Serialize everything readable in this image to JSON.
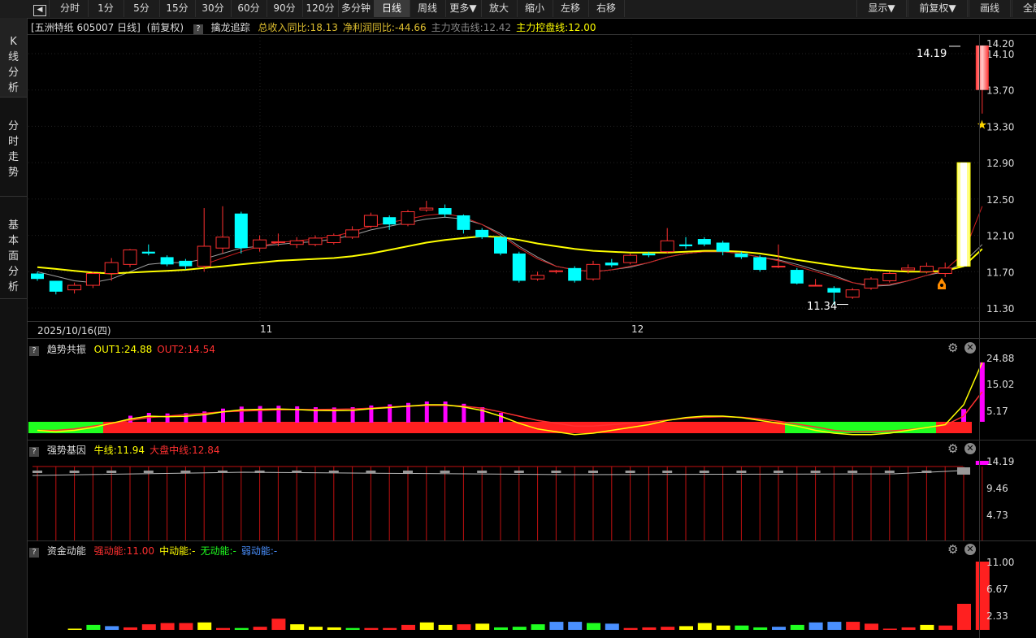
{
  "toolbar": {
    "buttons": [
      "分时",
      "1分",
      "5分",
      "15分",
      "30分",
      "60分",
      "90分",
      "120分",
      "多分钟",
      "日线",
      "周线",
      "更多▼",
      "放大",
      "缩小",
      "左移",
      "右移"
    ],
    "active": "日线",
    "right_buttons": [
      "显示▼",
      "前复权▼",
      "画线",
      "全屏"
    ]
  },
  "sidebar": {
    "tabs": [
      {
        "label": "K线分析",
        "chars": [
          "K",
          "线",
          "分",
          "析"
        ]
      },
      {
        "label": "分时走势",
        "chars": [
          "分",
          "时",
          "走",
          "势"
        ]
      },
      {
        "label": "基本面分析",
        "chars": [
          "基",
          "本",
          "面",
          "分",
          "析"
        ]
      }
    ]
  },
  "main_panel": {
    "stock": "[五洲特纸 605007 日线]",
    "adjust": "(前复权)",
    "indicator": "擒龙追踪",
    "items": [
      {
        "text": "总收入同比:18.13",
        "color": "#e0c030"
      },
      {
        "text": "净利润同比:-44.66",
        "color": "#e0c030"
      },
      {
        "text": "主力攻击线:12.42",
        "color": "#888888"
      },
      {
        "text": "主力控盘线:12.00",
        "color": "#ffff00"
      }
    ],
    "y_ticks": [
      "14.20",
      "14.10",
      "13.70",
      "13.30",
      "12.90",
      "12.50",
      "12.10",
      "11.70",
      "11.30"
    ],
    "high_label": "14.19",
    "low_label": "11.34",
    "dates": [
      "2025/10/16(四)",
      "11",
      "12"
    ]
  },
  "panel2": {
    "name": "趋势共振",
    "items": [
      {
        "text": "OUT1:24.88",
        "color": "#ffff00"
      },
      {
        "text": "OUT2:14.54",
        "color": "#ff3030"
      }
    ],
    "y_ticks": [
      "24.88",
      "15.02",
      "5.17"
    ]
  },
  "panel3": {
    "name": "强势基因",
    "items": [
      {
        "text": "牛线:11.94",
        "color": "#ffff00"
      },
      {
        "text": "大盘中线:12.84",
        "color": "#ff3030"
      }
    ],
    "y_ticks": [
      "14.19",
      "9.46",
      "4.73"
    ]
  },
  "panel4": {
    "name": "资金动能",
    "items": [
      {
        "text": "强动能:11.00",
        "color": "#ff3030"
      },
      {
        "text": "中动能:-",
        "color": "#ffff00"
      },
      {
        "text": "无动能:-",
        "color": "#20ff20"
      },
      {
        "text": "弱动能:-",
        "color": "#4a90ff"
      }
    ],
    "y_ticks": [
      "11.00",
      "6.67",
      "2.33"
    ]
  },
  "colors": {
    "up": "#ff3030",
    "down": "#00ffff",
    "ma_yellow": "#ffff00",
    "ma_gray": "#a0a0a0"
  },
  "chart_data": [
    {
      "type": "candlestick",
      "title": "五洲特纸 605007 日线",
      "candles": [
        {
          "o": 11.68,
          "h": 11.7,
          "l": 11.6,
          "c": 11.62
        },
        {
          "o": 11.6,
          "h": 11.6,
          "l": 11.45,
          "c": 11.48
        },
        {
          "o": 11.5,
          "h": 11.58,
          "l": 11.46,
          "c": 11.55
        },
        {
          "o": 11.55,
          "h": 11.7,
          "l": 11.52,
          "c": 11.68
        },
        {
          "o": 11.68,
          "h": 11.85,
          "l": 11.6,
          "c": 11.8
        },
        {
          "o": 11.78,
          "h": 11.95,
          "l": 11.75,
          "c": 11.94
        },
        {
          "o": 11.92,
          "h": 12.0,
          "l": 11.88,
          "c": 11.9
        },
        {
          "o": 11.86,
          "h": 11.88,
          "l": 11.76,
          "c": 11.78
        },
        {
          "o": 11.82,
          "h": 11.84,
          "l": 11.72,
          "c": 11.76
        },
        {
          "o": 11.76,
          "h": 12.4,
          "l": 11.7,
          "c": 11.98
        },
        {
          "o": 11.96,
          "h": 12.42,
          "l": 11.9,
          "c": 12.08
        },
        {
          "o": 12.34,
          "h": 12.36,
          "l": 11.9,
          "c": 11.96
        },
        {
          "o": 11.96,
          "h": 12.1,
          "l": 11.92,
          "c": 12.05
        },
        {
          "o": 12.02,
          "h": 12.12,
          "l": 11.98,
          "c": 12.03
        },
        {
          "o": 12.0,
          "h": 12.08,
          "l": 11.96,
          "c": 12.04
        },
        {
          "o": 12.0,
          "h": 12.1,
          "l": 11.98,
          "c": 12.07
        },
        {
          "o": 12.02,
          "h": 12.12,
          "l": 12.0,
          "c": 12.1
        },
        {
          "o": 12.08,
          "h": 12.2,
          "l": 12.06,
          "c": 12.16
        },
        {
          "o": 12.2,
          "h": 12.35,
          "l": 12.18,
          "c": 12.32
        },
        {
          "o": 12.3,
          "h": 12.32,
          "l": 12.16,
          "c": 12.22
        },
        {
          "o": 12.22,
          "h": 12.38,
          "l": 12.2,
          "c": 12.36
        },
        {
          "o": 12.38,
          "h": 12.48,
          "l": 12.36,
          "c": 12.4
        },
        {
          "o": 12.4,
          "h": 12.44,
          "l": 12.3,
          "c": 12.33
        },
        {
          "o": 12.32,
          "h": 12.33,
          "l": 12.12,
          "c": 12.16
        },
        {
          "o": 12.16,
          "h": 12.18,
          "l": 12.06,
          "c": 12.08
        },
        {
          "o": 12.08,
          "h": 12.1,
          "l": 11.88,
          "c": 11.9
        },
        {
          "o": 11.9,
          "h": 11.92,
          "l": 11.58,
          "c": 11.6
        },
        {
          "o": 11.62,
          "h": 11.7,
          "l": 11.6,
          "c": 11.66
        },
        {
          "o": 11.7,
          "h": 11.72,
          "l": 11.68,
          "c": 11.71
        },
        {
          "o": 11.74,
          "h": 11.76,
          "l": 11.58,
          "c": 11.6
        },
        {
          "o": 11.62,
          "h": 11.82,
          "l": 11.6,
          "c": 11.78
        },
        {
          "o": 11.8,
          "h": 11.84,
          "l": 11.75,
          "c": 11.77
        },
        {
          "o": 11.8,
          "h": 11.9,
          "l": 11.78,
          "c": 11.88
        },
        {
          "o": 11.9,
          "h": 11.92,
          "l": 11.86,
          "c": 11.88
        },
        {
          "o": 11.92,
          "h": 12.18,
          "l": 11.9,
          "c": 12.04
        },
        {
          "o": 12.0,
          "h": 12.08,
          "l": 11.95,
          "c": 11.98
        },
        {
          "o": 12.06,
          "h": 12.08,
          "l": 11.98,
          "c": 12.0
        },
        {
          "o": 12.02,
          "h": 12.04,
          "l": 11.88,
          "c": 11.92
        },
        {
          "o": 11.9,
          "h": 11.92,
          "l": 11.84,
          "c": 11.86
        },
        {
          "o": 11.86,
          "h": 11.88,
          "l": 11.7,
          "c": 11.72
        },
        {
          "o": 11.76,
          "h": 12.0,
          "l": 11.74,
          "c": 11.76
        },
        {
          "o": 11.72,
          "h": 11.74,
          "l": 11.56,
          "c": 11.57
        },
        {
          "o": 11.55,
          "h": 11.62,
          "l": 11.54,
          "c": 11.55
        },
        {
          "o": 11.52,
          "h": 11.54,
          "l": 11.34,
          "c": 11.47
        },
        {
          "o": 11.42,
          "h": 11.52,
          "l": 11.4,
          "c": 11.5
        },
        {
          "o": 11.52,
          "h": 11.64,
          "l": 11.5,
          "c": 11.62
        },
        {
          "o": 11.6,
          "h": 11.7,
          "l": 11.58,
          "c": 11.68
        },
        {
          "o": 11.72,
          "h": 11.78,
          "l": 11.68,
          "c": 11.74
        },
        {
          "o": 11.7,
          "h": 11.8,
          "l": 11.68,
          "c": 11.76
        },
        {
          "o": 11.68,
          "h": 11.8,
          "l": 11.64,
          "c": 11.74
        },
        {
          "o": 11.76,
          "h": 12.9,
          "l": 11.76,
          "c": 12.9
        },
        {
          "o": 14.19,
          "h": 14.19,
          "l": 13.44,
          "c": 13.7
        }
      ],
      "ma_yellow": [
        11.75,
        11.73,
        11.71,
        11.69,
        11.68,
        11.69,
        11.7,
        11.71,
        11.72,
        11.74,
        11.76,
        11.78,
        11.8,
        11.82,
        11.83,
        11.84,
        11.85,
        11.87,
        11.9,
        11.94,
        11.98,
        12.02,
        12.05,
        12.07,
        12.09,
        12.08,
        12.05,
        12.01,
        11.98,
        11.95,
        11.93,
        11.92,
        11.91,
        11.91,
        11.91,
        11.92,
        11.93,
        11.93,
        11.92,
        11.9,
        11.87,
        11.83,
        11.8,
        11.77,
        11.74,
        11.72,
        11.71,
        11.7,
        11.7,
        11.71,
        11.76,
        11.95
      ],
      "ma_gray": [
        11.7,
        11.65,
        11.6,
        11.58,
        11.62,
        11.7,
        11.78,
        11.8,
        11.8,
        11.84,
        11.9,
        11.96,
        11.98,
        12.0,
        12.02,
        12.03,
        12.06,
        12.1,
        12.16,
        12.2,
        12.24,
        12.28,
        12.3,
        12.28,
        12.22,
        12.12,
        11.98,
        11.86,
        11.76,
        11.72,
        11.7,
        11.72,
        11.75,
        11.8,
        11.86,
        11.9,
        11.92,
        11.92,
        11.9,
        11.86,
        11.83,
        11.78,
        11.72,
        11.66,
        11.58,
        11.54,
        11.55,
        11.6,
        11.66,
        11.7,
        11.8,
        12.0
      ],
      "ma_red": [
        null,
        null,
        null,
        null,
        null,
        null,
        null,
        null,
        null,
        11.78,
        11.85,
        11.92,
        11.98,
        12.02,
        12.04,
        12.06,
        12.09,
        12.14,
        12.2,
        12.24,
        12.28,
        12.32,
        12.34,
        12.3,
        12.22,
        12.1,
        11.96,
        11.84,
        11.76,
        11.72,
        11.7,
        11.72,
        11.76,
        11.8,
        11.86,
        11.9,
        11.92,
        11.92,
        11.9,
        11.86,
        11.82,
        11.76,
        11.7,
        11.64,
        11.58,
        11.55,
        11.56,
        11.6,
        11.66,
        11.72,
        11.9,
        12.42
      ],
      "ylim": [
        11.25,
        14.25
      ]
    },
    {
      "type": "bar",
      "title": "趋势共振",
      "series": [
        {
          "name": "OUT1",
          "values": [
            1.0,
            0.5,
            1.0,
            2.0,
            3.5,
            5.0,
            6.0,
            5.8,
            5.9,
            6.5,
            7.5,
            8.2,
            8.4,
            8.5,
            8.3,
            8.0,
            7.9,
            8.0,
            8.6,
            9.0,
            9.5,
            10.0,
            10.0,
            9.2,
            8.0,
            6.0,
            3.5,
            1.5,
            0.5,
            -0.5,
            0.0,
            1.0,
            2.0,
            3.0,
            4.5,
            5.5,
            6.0,
            6.0,
            5.5,
            4.5,
            3.5,
            2.5,
            1.0,
            0.0,
            -0.5,
            -0.5,
            0.0,
            1.0,
            2.0,
            3.0,
            10.0,
            24.88
          ]
        },
        {
          "name": "OUT2",
          "values": [
            1.0,
            1.0,
            1.5,
            2.5,
            3.5,
            4.5,
            5.5,
            6.0,
            6.5,
            7.0,
            7.5,
            7.8,
            8.0,
            8.2,
            8.3,
            8.3,
            8.4,
            8.5,
            8.8,
            9.2,
            9.5,
            9.8,
            9.8,
            9.5,
            8.8,
            7.5,
            6.0,
            4.5,
            3.5,
            2.5,
            2.5,
            3.0,
            3.5,
            4.0,
            4.6,
            5.2,
            5.6,
            5.8,
            5.6,
            5.0,
            4.2,
            3.2,
            2.2,
            1.0,
            0.5,
            0.5,
            0.8,
            1.2,
            2.0,
            2.8,
            6.0,
            14.54
          ]
        }
      ],
      "ylim": [
        0,
        26
      ]
    },
    {
      "type": "bar",
      "title": "强势基因",
      "series": [
        {
          "name": "牛线",
          "values": [
            11.94
          ]
        },
        {
          "name": "大盘中线",
          "values": [
            12.84
          ]
        }
      ],
      "ylim": [
        0,
        15
      ]
    },
    {
      "type": "bar",
      "title": "资金动能",
      "values": [
        0.2,
        0.8,
        0.6,
        0.4,
        0.9,
        1.1,
        1.1,
        1.2,
        0.3,
        0.3,
        0.5,
        1.8,
        0.9,
        0.5,
        0.4,
        0.3,
        0.3,
        0.3,
        0.8,
        1.2,
        0.8,
        0.9,
        1.0,
        0.4,
        0.5,
        0.9,
        1.3,
        1.3,
        1.1,
        1.0,
        0.3,
        0.4,
        0.5,
        0.6,
        1.1,
        0.7,
        0.7,
        0.4,
        0.5,
        0.8,
        1.2,
        1.3,
        1.3,
        1.0,
        0.2,
        0.4,
        0.8,
        0.7,
        4.2,
        11.0
      ],
      "bar_colors": [
        "#ffff00",
        "#20ff20",
        "#4a90ff",
        "#ff2020",
        "#ff2020",
        "#ff2020",
        "#ff2020",
        "#ffff00",
        "#ff2020",
        "#20ff20",
        "#ff2020",
        "#ff2020",
        "#ffff00",
        "#ffff00",
        "#ffff00",
        "#20ff20",
        "#ff2020",
        "#ff2020",
        "#ff2020",
        "#ffff00",
        "#ffff00",
        "#ff2020",
        "#ffff00",
        "#20ff20",
        "#20ff20",
        "#20ff20",
        "#4a90ff",
        "#4a90ff",
        "#20ff20",
        "#4a90ff",
        "#ff2020",
        "#ff2020",
        "#ff2020",
        "#ffff00",
        "#ffff00",
        "#ffff00",
        "#20ff20",
        "#20ff20",
        "#4a90ff",
        "#20ff20",
        "#4a90ff",
        "#4a90ff",
        "#ff2020",
        "#ff2020",
        "#ff2020",
        "#ff2020",
        "#ffff00",
        "#ff2020",
        "#ff2020",
        "#ff2020"
      ],
      "ylim": [
        0,
        11.5
      ]
    }
  ]
}
